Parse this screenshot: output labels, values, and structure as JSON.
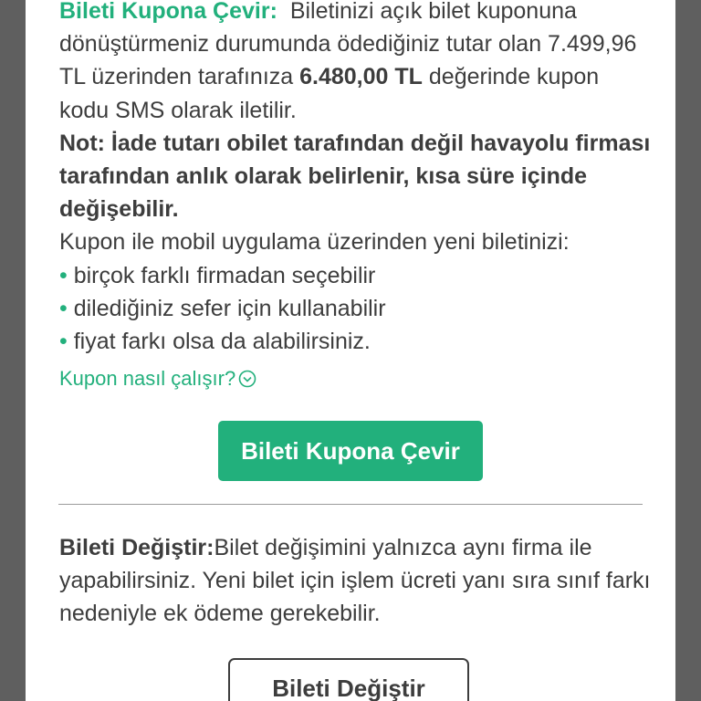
{
  "coupon": {
    "title": "Bileti Kupona Çevir:",
    "desc_a": "Biletinizi açık bilet kuponuna dönüştürmeniz durumunda ödediğiniz tutar olan 7.499,96 TL üzerinden tarafınıza",
    "amount": "6.480,00 TL",
    "desc_b": "değerinde kupon kodu SMS olarak iletilir.",
    "note": "Not: İade tutarı obilet tarafından değil havayolu firması tarafından anlık olarak belirlenir, kısa süre içinde değişebilir.",
    "intro": "Kupon ile mobil uygulama üzerinden yeni biletinizi:",
    "bullets": [
      "birçok farklı firmadan seçebilir",
      "dilediğiniz sefer için kullanabilir",
      "fiyat farkı olsa da alabilirsiniz."
    ],
    "how_link": "Kupon nasıl çalışır?",
    "button": "Bileti Kupona Çevir"
  },
  "change": {
    "title": "Bileti Değiştir:",
    "desc": "Bilet değişimini yalnızca aynı firma ile yapabilirsiniz. Yeni bilet için işlem ücreti yanı sıra sınıf farkı nedeniyle ek ödeme gerekebilir.",
    "button": "Bileti Değiştir"
  },
  "colors": {
    "accent": "#22b07c",
    "text": "#3d3d3d",
    "overlay": "#5f5f5f"
  }
}
